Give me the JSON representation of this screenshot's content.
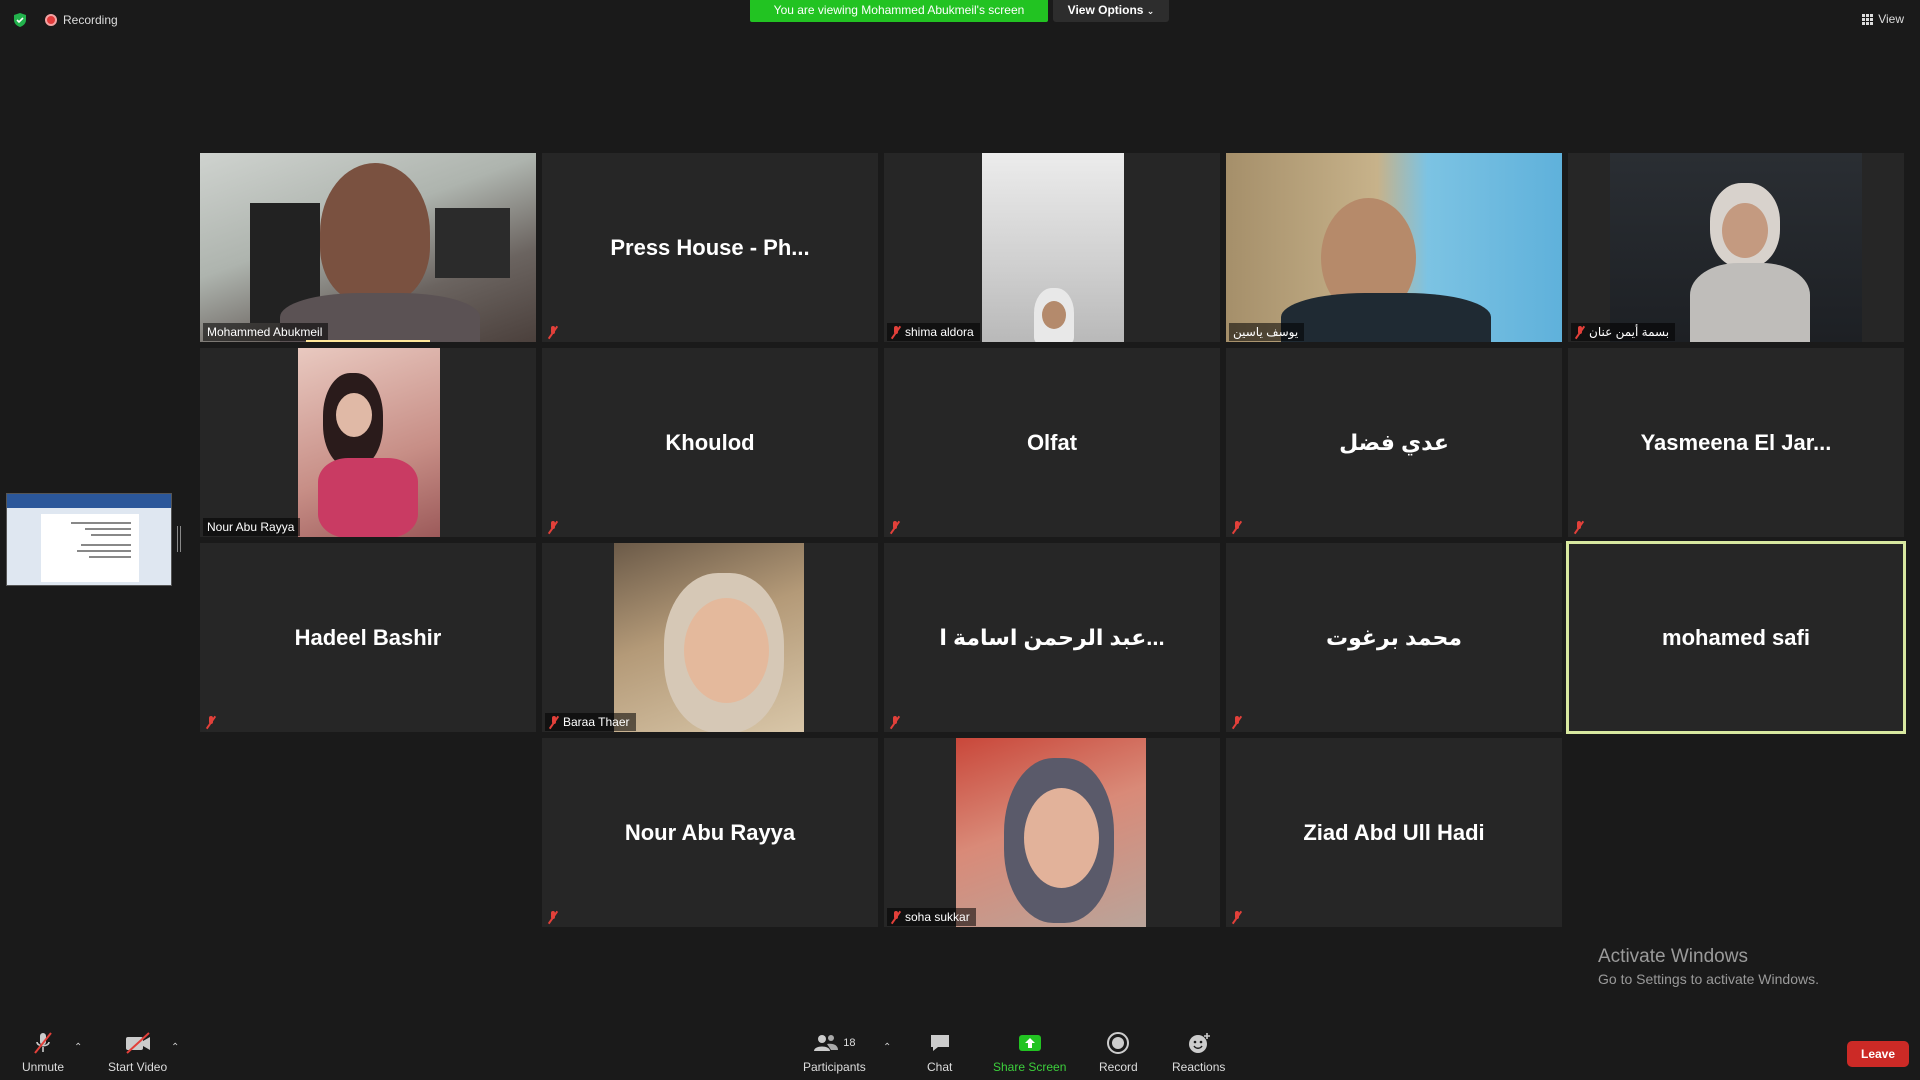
{
  "top": {
    "recording_label": "Recording",
    "viewing_banner": "You are viewing Mohammed Abukmeil's screen",
    "view_options_label": "View Options",
    "view_label": "View"
  },
  "tiles": {
    "t0": {
      "name": "Mohammed Abukmeil"
    },
    "t1": {
      "name": "Press House - Ph..."
    },
    "t2": {
      "name": "shima aldora"
    },
    "t3": {
      "name": "يوسف ياسين"
    },
    "t4": {
      "name": "بسمة أيمن عنان"
    },
    "t5": {
      "name": "Nour Abu Rayya"
    },
    "t6": {
      "name": "Khoulod"
    },
    "t7": {
      "name": "Olfat"
    },
    "t8": {
      "name": "عدي فضل"
    },
    "t9": {
      "name": "Yasmeena El Jar..."
    },
    "t10": {
      "name": "Hadeel Bashir"
    },
    "t11": {
      "name": "Baraa Thaer"
    },
    "t12": {
      "name": "عبد الرحمن اسامة ا..."
    },
    "t13": {
      "name": "محمد برغوت"
    },
    "t14": {
      "name": "mohamed safi"
    },
    "t15": {
      "name": "Nour Abu Rayya"
    },
    "t16": {
      "name": "soha sukkar"
    },
    "t17": {
      "name": "Ziad Abd Ull Hadi"
    }
  },
  "watermark": {
    "line1": "Activate Windows",
    "line2": "Go to Settings to activate Windows."
  },
  "toolbar": {
    "unmute": "Unmute",
    "start_video": "Start Video",
    "participants": "Participants",
    "participants_count": "18",
    "chat": "Chat",
    "share_screen": "Share Screen",
    "record": "Record",
    "reactions": "Reactions",
    "leave": "Leave"
  },
  "colors": {
    "banner_green": "#22c322",
    "share_green": "#22c322",
    "active_speaker_border": "#d8e8a0",
    "leave_red": "#cc2a26",
    "muted_red": "#e2403a"
  }
}
